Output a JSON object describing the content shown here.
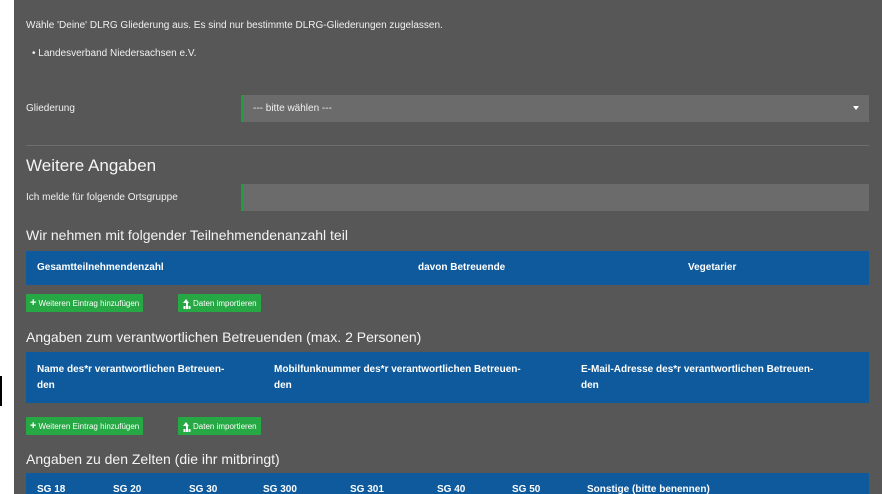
{
  "intro": {
    "text": "Wähle 'Deine' DLRG Gliederung aus. Es sind nur bestimmte DLRG-Gliederungen zugelassen.",
    "bullet": "•  Landesverband Niedersachsen e.V."
  },
  "gliederung": {
    "label": "Gliederung",
    "value": "--- bitte wählen ---"
  },
  "weitere": {
    "title": "Weitere Angaben",
    "ortsgruppe_label": "Ich melde für folgende Ortsgruppe",
    "ortsgruppe_value": ""
  },
  "teilnehmer": {
    "title": "Wir nehmen mit folgender Teilnehmendenanzahl teil",
    "headers": [
      "Gesamtteilnehmendenzahl",
      "davon Betreuende",
      "Vegetarier"
    ]
  },
  "buttons": {
    "add": "Weiteren Eintrag hinzufügen",
    "import": "Daten importieren"
  },
  "betreuende": {
    "title": "Angaben zum verantwortlichen Betreuenden (max. 2 Personen)",
    "headers": [
      {
        "l1": "Name des*r verantwortlichen Betreuen-",
        "l2": "den"
      },
      {
        "l1": "Mobilfunknummer des*r verantwortlichen Betreuen-",
        "l2": "den"
      },
      {
        "l1": "E-Mail-Adresse des*r verantwortlichen Betreuen-",
        "l2": "den"
      }
    ]
  },
  "zelte": {
    "title": "Angaben zu den Zelten (die ihr mitbringt)",
    "headers": [
      "SG 18",
      "SG 20",
      "SG 30",
      "SG 300",
      "SG 301",
      "SG 40",
      "SG 50",
      "Sonstige (bitte benennen)"
    ]
  },
  "colors": {
    "panel": "#575757",
    "header": "#0e5a9c",
    "button": "#26a844",
    "accent": "#1e9e3e"
  }
}
